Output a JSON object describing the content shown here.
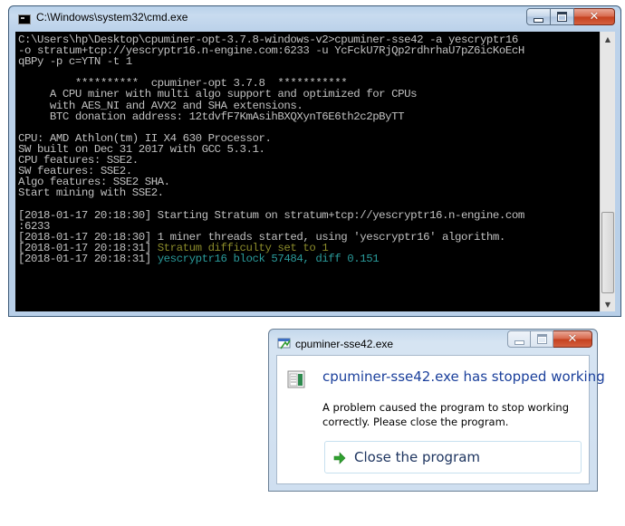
{
  "cmd_window": {
    "title": "C:\\Windows\\system32\\cmd.exe",
    "controls": {
      "minimize": "minimize",
      "maximize": "maximize",
      "close": "close"
    },
    "console_lines": [
      {
        "text": "C:\\Users\\hp\\Desktop\\cpuminer-opt-3.7.8-windows-v2>cpuminer-sse42 -a yescryptr16",
        "color": "#c0c0c0"
      },
      {
        "text": "-o stratum+tcp://yescryptr16.n-engine.com:6233 -u YcFckU7RjQp2rdhrhaU7pZ6icKoEcH",
        "color": "#c0c0c0"
      },
      {
        "text": "qBPy -p c=YTN -t 1",
        "color": "#c0c0c0"
      },
      {
        "text": "",
        "color": "#c0c0c0"
      },
      {
        "text": "         **********  cpuminer-opt 3.7.8  ***********",
        "color": "#c0c0c0"
      },
      {
        "text": "     A CPU miner with multi algo support and optimized for CPUs",
        "color": "#c0c0c0"
      },
      {
        "text": "     with AES_NI and AVX2 and SHA extensions.",
        "color": "#c0c0c0"
      },
      {
        "text": "     BTC donation address: 12tdvfF7KmAsihBXQXynT6E6th2c2pByTT",
        "color": "#c0c0c0"
      },
      {
        "text": "",
        "color": "#c0c0c0"
      },
      {
        "text": "CPU: AMD Athlon(tm) II X4 630 Processor.",
        "color": "#c0c0c0"
      },
      {
        "text": "SW built on Dec 31 2017 with GCC 5.3.1.",
        "color": "#c0c0c0"
      },
      {
        "text": "CPU features: SSE2.",
        "color": "#c0c0c0"
      },
      {
        "text": "SW features: SSE2.",
        "color": "#c0c0c0"
      },
      {
        "text": "Algo features: SSE2 SHA.",
        "color": "#c0c0c0"
      },
      {
        "text": "Start mining with SSE2.",
        "color": "#c0c0c0"
      },
      {
        "text": "",
        "color": "#c0c0c0"
      },
      {
        "text": "[2018-01-17 20:18:30] Starting Stratum on stratum+tcp://yescryptr16.n-engine.com",
        "color": "#c0c0c0"
      },
      {
        "text": ":6233",
        "color": "#c0c0c0"
      },
      {
        "text": "[2018-01-17 20:18:30] 1 miner threads started, using 'yescryptr16' algorithm.",
        "color": "#c0c0c0"
      },
      {
        "prefix": "[2018-01-17 20:18:31] ",
        "text": "Stratum difficulty set to 1",
        "color": "#8a8a2a"
      },
      {
        "prefix": "[2018-01-17 20:18:31] ",
        "text": "yescryptr16 block 57484, diff 0.151",
        "color": "#2a9a9a"
      }
    ]
  },
  "error_dialog": {
    "title": "cpuminer-sse42.exe",
    "main_instruction": "cpuminer-sse42.exe has stopped working",
    "description": "A problem caused the program to stop working correctly. Please close the program.",
    "command_link": "Close the program"
  }
}
